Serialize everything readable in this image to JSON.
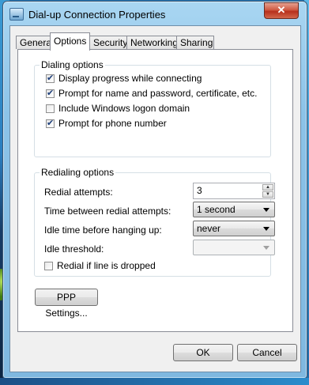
{
  "window": {
    "title": "Dial-up Connection Properties",
    "close_label": "✕"
  },
  "tabs": [
    {
      "label": "General",
      "active": false
    },
    {
      "label": "Options",
      "active": true
    },
    {
      "label": "Security",
      "active": false
    },
    {
      "label": "Networking",
      "active": false
    },
    {
      "label": "Sharing",
      "active": false
    }
  ],
  "dialing_options": {
    "title": "Dialing options",
    "items": [
      {
        "label": "Display progress while connecting",
        "checked": true
      },
      {
        "label": "Prompt for name and password, certificate, etc.",
        "checked": true
      },
      {
        "label": "Include Windows logon domain",
        "checked": false
      },
      {
        "label": "Prompt for phone number",
        "checked": true
      }
    ]
  },
  "redialing_options": {
    "title": "Redialing options",
    "redial_attempts_label": "Redial attempts:",
    "redial_attempts_value": "3",
    "time_between_label": "Time between redial attempts:",
    "time_between_value": "1 second",
    "idle_time_label": "Idle time before hanging up:",
    "idle_time_value": "never",
    "idle_threshold_label": "Idle threshold:",
    "idle_threshold_value": "",
    "redial_if_dropped_label": "Redial if line is dropped",
    "redial_if_dropped_checked": false
  },
  "ppp_settings_label": "PPP Settings...",
  "footer": {
    "ok_label": "OK",
    "cancel_label": "Cancel"
  }
}
